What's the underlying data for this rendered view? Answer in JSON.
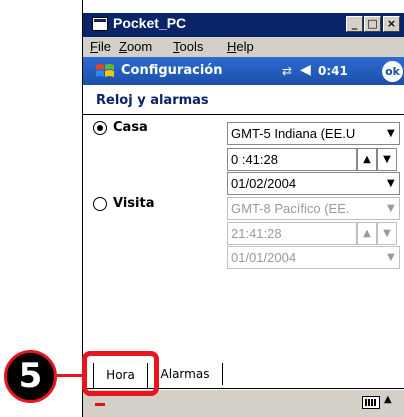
{
  "window": {
    "title": "Pocket_PC",
    "buttons": {
      "minimize": "_",
      "maximize": "□",
      "close": "×"
    }
  },
  "menubar": {
    "items": [
      {
        "pre": "",
        "key": "F",
        "post": "ile"
      },
      {
        "pre": "",
        "key": "Z",
        "post": "oom"
      },
      {
        "pre": "",
        "key": "T",
        "post": "ools"
      },
      {
        "pre": "",
        "key": "H",
        "post": "elp"
      }
    ]
  },
  "device": {
    "title": "Configuración",
    "time": "0:41",
    "ok_label": "ok",
    "icons": {
      "start": "windows-flag-icon",
      "connectivity": "connectivity-icon",
      "volume": "speaker-icon"
    }
  },
  "section_title": "Reloj y alarmas",
  "home": {
    "label": "Casa",
    "selected": true,
    "timezone": "GMT-5 Indiana (EE.U",
    "time": "0 :41:28",
    "date": "01/02/2004"
  },
  "visit": {
    "label": "Visita",
    "selected": false,
    "timezone": "GMT-8 Pacífico (EE.",
    "time": "21:41:28",
    "date": "01/01/2004"
  },
  "tabs": [
    "Hora",
    "Alarmas"
  ],
  "callout": {
    "number": "5"
  },
  "colors": {
    "titlebar": "#0a246a",
    "device_header": "#1a4fa8",
    "callout": "#e8141e"
  }
}
